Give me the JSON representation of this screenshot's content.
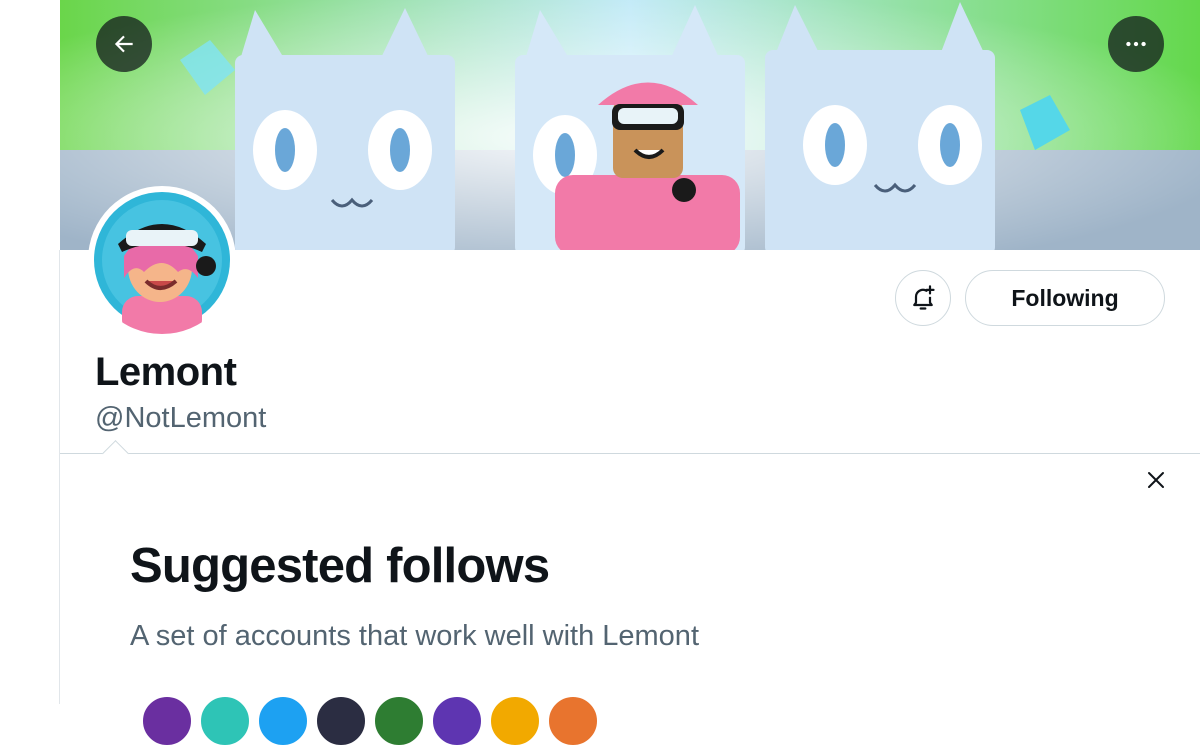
{
  "nav": {
    "back_icon": "arrow-left-icon",
    "more_icon": "more-horizontal-icon"
  },
  "profile": {
    "display_name": "Lemont",
    "handle": "@NotLemont",
    "following_label": "Following",
    "notify_icon": "bell-plus-icon"
  },
  "suggested": {
    "title": "Suggested follows",
    "subtitle": "A set of accounts that work well with Lemont",
    "close_icon": "close-icon",
    "avatar_colors": [
      "#6a2fa0",
      "#2ec4b6",
      "#1da1f2",
      "#2b2d42",
      "#2e7d32",
      "#5e35b1",
      "#f2a900",
      "#e8742e"
    ]
  },
  "colors": {
    "text_primary": "#0f1419",
    "text_secondary": "#536471",
    "border": "#cfd9de",
    "banner_sky": "#5bd34a",
    "cat_body": "#cfe3f5",
    "hoodie_pink": "#f27aa8"
  }
}
